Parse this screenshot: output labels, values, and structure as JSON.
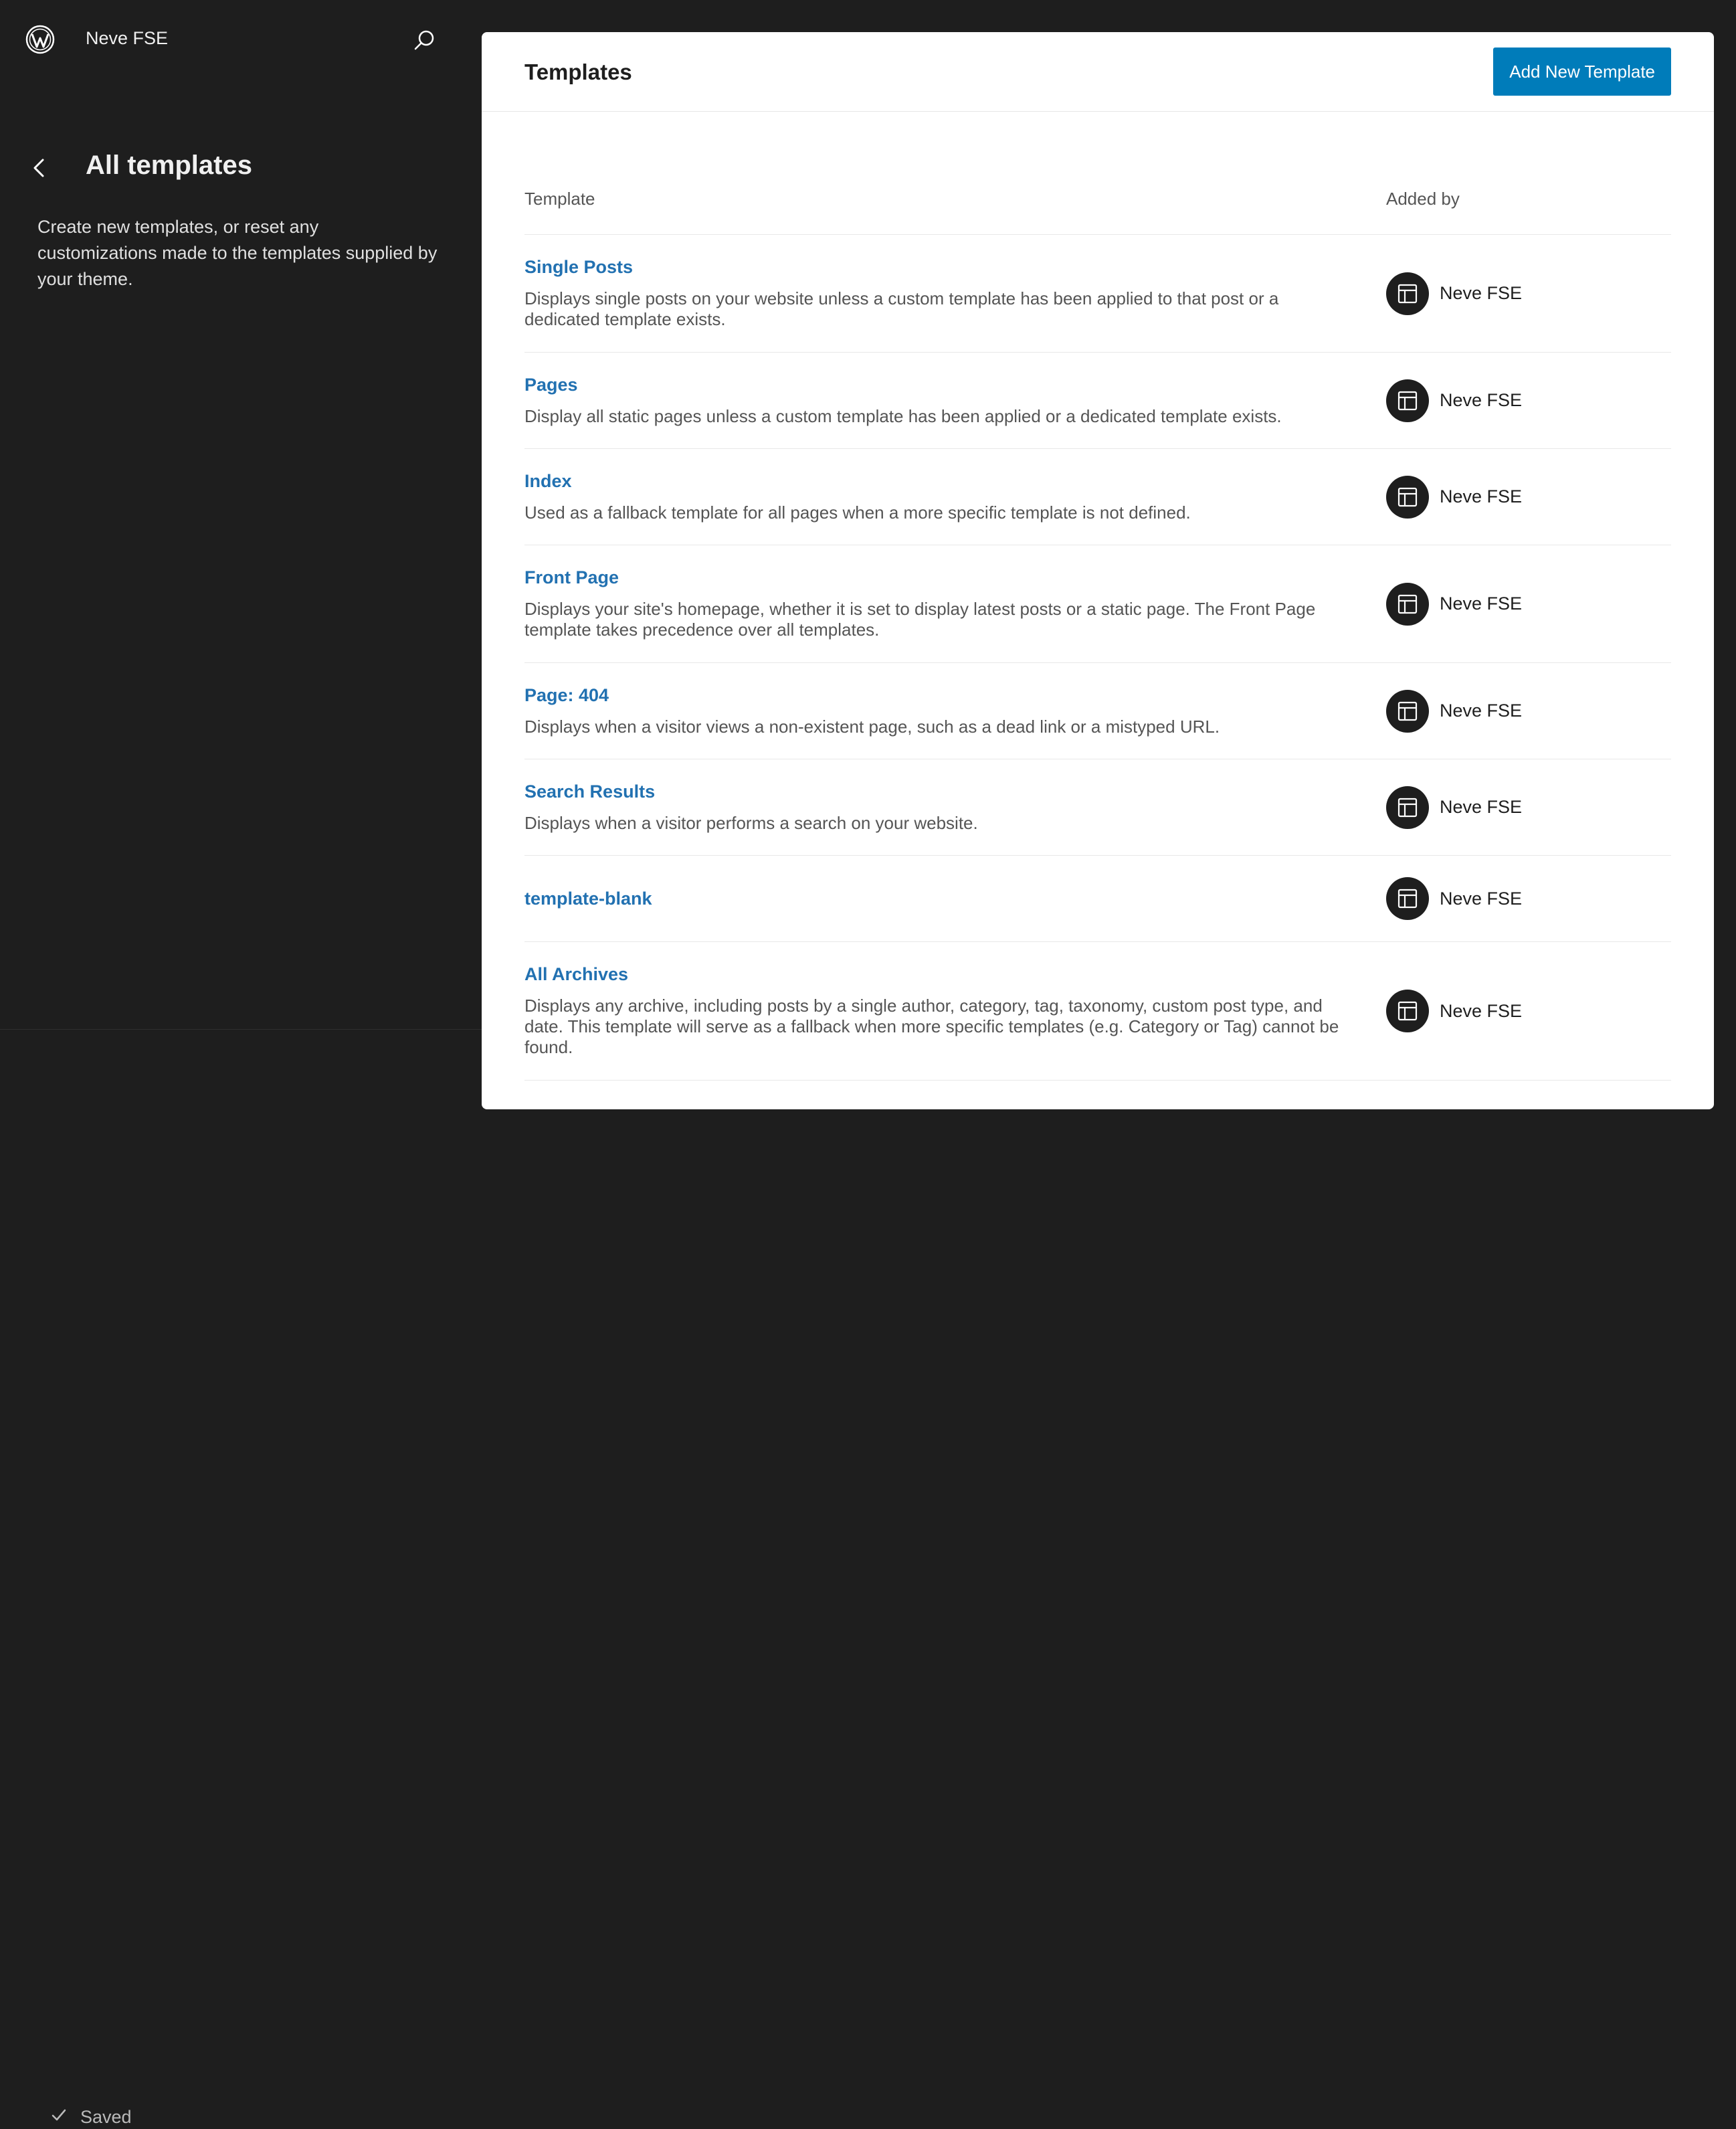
{
  "sidebar": {
    "site_title": "Neve FSE",
    "heading": "All templates",
    "description": "Create new templates, or reset any customizations made to the templates supplied by your theme.",
    "status": "Saved",
    "icons": {
      "logo": "wordpress-logo-icon",
      "search": "search-icon",
      "back": "chevron-left-icon",
      "status": "check-icon"
    }
  },
  "main": {
    "title": "Templates",
    "add_button": "Add New Template",
    "columns": {
      "template": "Template",
      "added_by": "Added by"
    },
    "rows": [
      {
        "title": "Single Posts",
        "description": "Displays single posts on your website unless a custom template has been applied to that post or a dedicated template exists.",
        "author": "Neve FSE"
      },
      {
        "title": "Pages",
        "description": "Display all static pages unless a custom template has been applied or a dedicated template exists.",
        "author": "Neve FSE"
      },
      {
        "title": "Index",
        "description": "Used as a fallback template for all pages when a more specific template is not defined.",
        "author": "Neve FSE"
      },
      {
        "title": "Front Page",
        "description": "Displays your site's homepage, whether it is set to display latest posts or a static page. The Front Page template takes precedence over all templates.",
        "author": "Neve FSE"
      },
      {
        "title": "Page: 404",
        "description": "Displays when a visitor views a non-existent page, such as a dead link or a mistyped URL.",
        "author": "Neve FSE"
      },
      {
        "title": "Search Results",
        "description": "Displays when a visitor performs a search on your website.",
        "author": "Neve FSE"
      },
      {
        "title": "template-blank",
        "description": "",
        "author": "Neve FSE"
      },
      {
        "title": "All Archives",
        "description": "Displays any archive, including posts by a single author, category, tag, taxonomy, custom post type, and date. This template will serve as a fallback when more specific templates (e.g. Category or Tag) cannot be found.",
        "author": "Neve FSE"
      }
    ]
  },
  "colors": {
    "sidebar_bg": "#1e1e1e",
    "accent": "#007cba",
    "link": "#2271b1"
  }
}
